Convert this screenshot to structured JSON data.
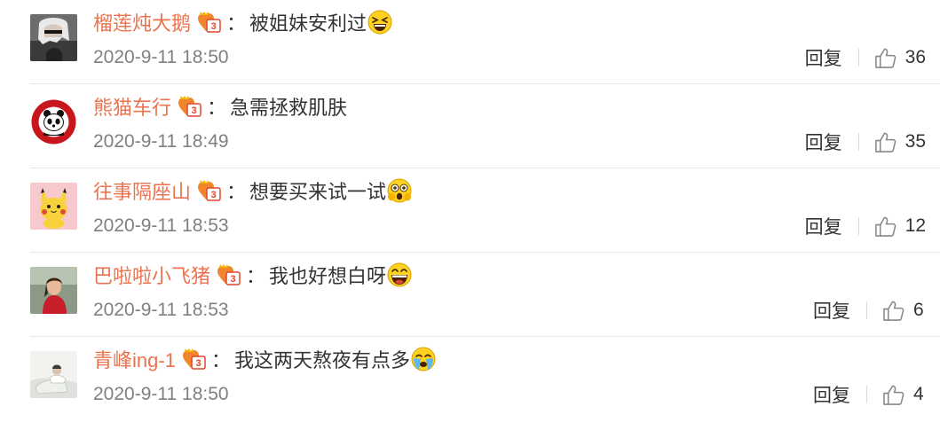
{
  "comments": [
    {
      "username": "榴莲炖大鹅",
      "text": "被姐妹安利过",
      "emoji": "laughing-squint-emoji",
      "time": "2020-9-11 18:50",
      "reply_label": "回复",
      "likes": "36",
      "avatar": "anime-character-avatar"
    },
    {
      "username": "熊猫车行",
      "text": "急需拯救肌肤",
      "emoji": "",
      "time": "2020-9-11 18:49",
      "reply_label": "回复",
      "likes": "35",
      "avatar": "panda-dealership-logo-avatar"
    },
    {
      "username": "往事隔座山",
      "text": "想要买来试一试",
      "emoji": "shocked-face-emoji",
      "time": "2020-9-11 18:53",
      "reply_label": "回复",
      "likes": "12",
      "avatar": "pikachu-avatar"
    },
    {
      "username": "巴啦啦小飞猪",
      "text": "我也好想白呀",
      "emoji": "grinning-face-emoji",
      "time": "2020-9-11 18:53",
      "reply_label": "回复",
      "likes": "6",
      "avatar": "person-photo-avatar"
    },
    {
      "username": "青峰ing-1",
      "text": "我这两天熬夜有点多",
      "emoji": "crying-face-emoji",
      "time": "2020-9-11 18:50",
      "reply_label": "回复",
      "likes": "4",
      "avatar": "photo-avatar"
    }
  ],
  "colors": {
    "username": "#eb7350",
    "text": "#333333",
    "time": "#808080",
    "divider": "#e6e6e6"
  }
}
